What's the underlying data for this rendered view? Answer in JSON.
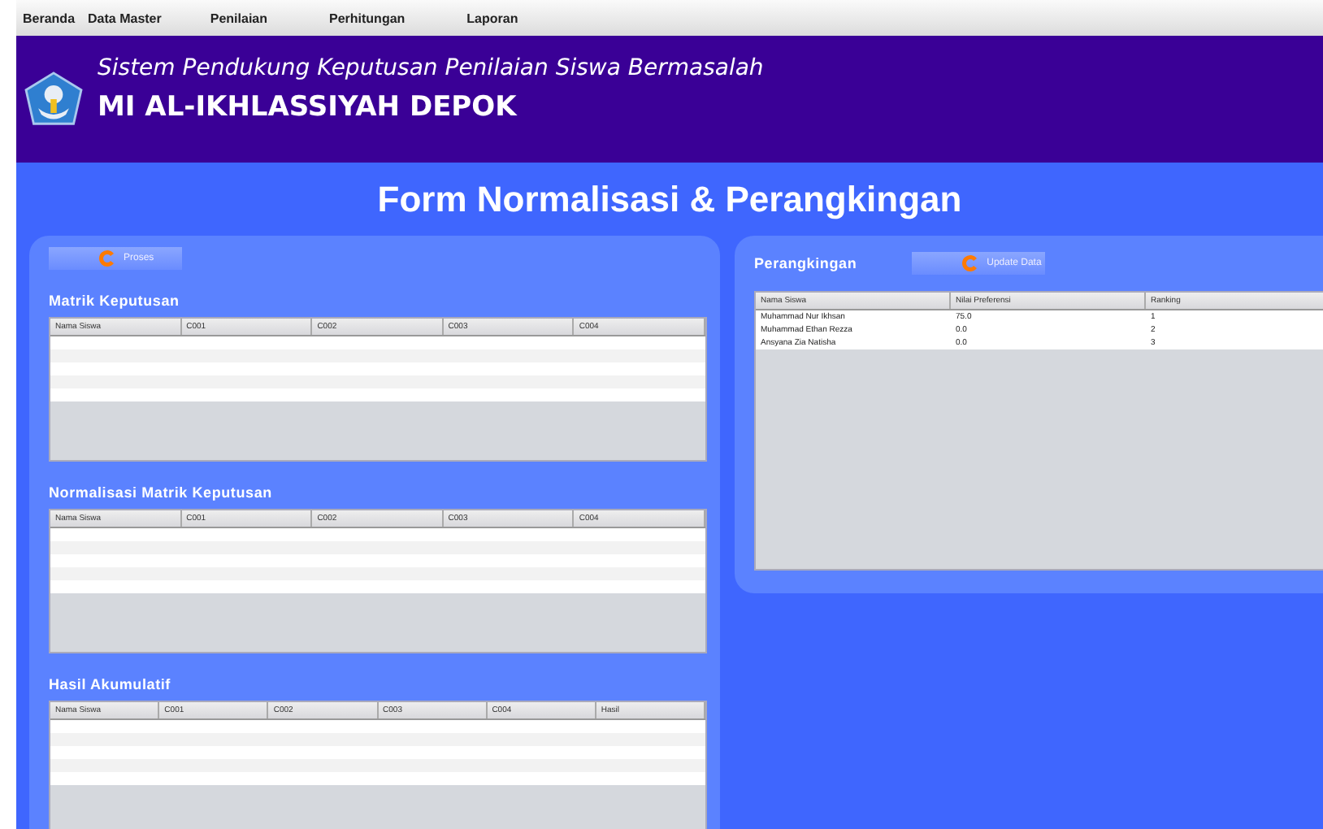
{
  "menu": [
    "Beranda",
    "Data Master",
    "Penilaian",
    "Perhitungan",
    "Laporan"
  ],
  "header": {
    "subtitle": "Sistem Pendukung Keputusan Penilaian Siswa Bermasalah",
    "school": "MI AL-IKHLASSIYAH DEPOK"
  },
  "form_title": "Form Normalisasi & Perangkingan",
  "left_panel": {
    "button": "Proses",
    "sections": [
      {
        "title": "Matrik Keputusan",
        "columns": [
          "Nama Siswa",
          "C001",
          "C002",
          "C003",
          "C004"
        ]
      },
      {
        "title": "Normalisasi Matrik Keputusan",
        "columns": [
          "Nama Siswa",
          "C001",
          "C002",
          "C003",
          "C004"
        ]
      },
      {
        "title": "Hasil Akumulatif",
        "columns": [
          "Nama Siswa",
          "C001",
          "C002",
          "C003",
          "C004",
          "Hasil"
        ]
      }
    ]
  },
  "right_panel": {
    "title": "Perangkingan",
    "button": "Update Data",
    "columns": [
      "Nama Siswa",
      "Nilai Preferensi",
      "Ranking"
    ],
    "rows": [
      [
        "Muhammad Nur Ikhsan",
        "75.0",
        "1"
      ],
      [
        "Muhammad Ethan Rezza",
        "0.0",
        "2"
      ],
      [
        "Ansyana Zia Natisha",
        "0.0",
        "3"
      ]
    ]
  }
}
